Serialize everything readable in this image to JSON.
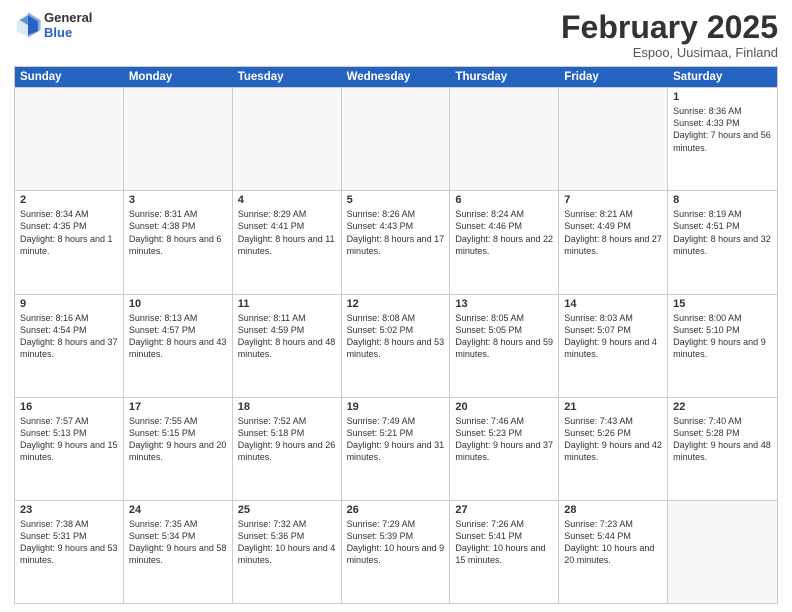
{
  "header": {
    "logo_general": "General",
    "logo_blue": "Blue",
    "month_title": "February 2025",
    "location": "Espoo, Uusimaa, Finland"
  },
  "calendar": {
    "days_of_week": [
      "Sunday",
      "Monday",
      "Tuesday",
      "Wednesday",
      "Thursday",
      "Friday",
      "Saturday"
    ],
    "rows": [
      [
        {
          "day": "",
          "info": "",
          "empty": true
        },
        {
          "day": "",
          "info": "",
          "empty": true
        },
        {
          "day": "",
          "info": "",
          "empty": true
        },
        {
          "day": "",
          "info": "",
          "empty": true
        },
        {
          "day": "",
          "info": "",
          "empty": true
        },
        {
          "day": "",
          "info": "",
          "empty": true
        },
        {
          "day": "1",
          "info": "Sunrise: 8:36 AM\nSunset: 4:33 PM\nDaylight: 7 hours and 56 minutes.",
          "empty": false
        }
      ],
      [
        {
          "day": "2",
          "info": "Sunrise: 8:34 AM\nSunset: 4:35 PM\nDaylight: 8 hours and 1 minute.",
          "empty": false
        },
        {
          "day": "3",
          "info": "Sunrise: 8:31 AM\nSunset: 4:38 PM\nDaylight: 8 hours and 6 minutes.",
          "empty": false
        },
        {
          "day": "4",
          "info": "Sunrise: 8:29 AM\nSunset: 4:41 PM\nDaylight: 8 hours and 11 minutes.",
          "empty": false
        },
        {
          "day": "5",
          "info": "Sunrise: 8:26 AM\nSunset: 4:43 PM\nDaylight: 8 hours and 17 minutes.",
          "empty": false
        },
        {
          "day": "6",
          "info": "Sunrise: 8:24 AM\nSunset: 4:46 PM\nDaylight: 8 hours and 22 minutes.",
          "empty": false
        },
        {
          "day": "7",
          "info": "Sunrise: 8:21 AM\nSunset: 4:49 PM\nDaylight: 8 hours and 27 minutes.",
          "empty": false
        },
        {
          "day": "8",
          "info": "Sunrise: 8:19 AM\nSunset: 4:51 PM\nDaylight: 8 hours and 32 minutes.",
          "empty": false
        }
      ],
      [
        {
          "day": "9",
          "info": "Sunrise: 8:16 AM\nSunset: 4:54 PM\nDaylight: 8 hours and 37 minutes.",
          "empty": false
        },
        {
          "day": "10",
          "info": "Sunrise: 8:13 AM\nSunset: 4:57 PM\nDaylight: 8 hours and 43 minutes.",
          "empty": false
        },
        {
          "day": "11",
          "info": "Sunrise: 8:11 AM\nSunset: 4:59 PM\nDaylight: 8 hours and 48 minutes.",
          "empty": false
        },
        {
          "day": "12",
          "info": "Sunrise: 8:08 AM\nSunset: 5:02 PM\nDaylight: 8 hours and 53 minutes.",
          "empty": false
        },
        {
          "day": "13",
          "info": "Sunrise: 8:05 AM\nSunset: 5:05 PM\nDaylight: 8 hours and 59 minutes.",
          "empty": false
        },
        {
          "day": "14",
          "info": "Sunrise: 8:03 AM\nSunset: 5:07 PM\nDaylight: 9 hours and 4 minutes.",
          "empty": false
        },
        {
          "day": "15",
          "info": "Sunrise: 8:00 AM\nSunset: 5:10 PM\nDaylight: 9 hours and 9 minutes.",
          "empty": false
        }
      ],
      [
        {
          "day": "16",
          "info": "Sunrise: 7:57 AM\nSunset: 5:13 PM\nDaylight: 9 hours and 15 minutes.",
          "empty": false
        },
        {
          "day": "17",
          "info": "Sunrise: 7:55 AM\nSunset: 5:15 PM\nDaylight: 9 hours and 20 minutes.",
          "empty": false
        },
        {
          "day": "18",
          "info": "Sunrise: 7:52 AM\nSunset: 5:18 PM\nDaylight: 9 hours and 26 minutes.",
          "empty": false
        },
        {
          "day": "19",
          "info": "Sunrise: 7:49 AM\nSunset: 5:21 PM\nDaylight: 9 hours and 31 minutes.",
          "empty": false
        },
        {
          "day": "20",
          "info": "Sunrise: 7:46 AM\nSunset: 5:23 PM\nDaylight: 9 hours and 37 minutes.",
          "empty": false
        },
        {
          "day": "21",
          "info": "Sunrise: 7:43 AM\nSunset: 5:26 PM\nDaylight: 9 hours and 42 minutes.",
          "empty": false
        },
        {
          "day": "22",
          "info": "Sunrise: 7:40 AM\nSunset: 5:28 PM\nDaylight: 9 hours and 48 minutes.",
          "empty": false
        }
      ],
      [
        {
          "day": "23",
          "info": "Sunrise: 7:38 AM\nSunset: 5:31 PM\nDaylight: 9 hours and 53 minutes.",
          "empty": false
        },
        {
          "day": "24",
          "info": "Sunrise: 7:35 AM\nSunset: 5:34 PM\nDaylight: 9 hours and 58 minutes.",
          "empty": false
        },
        {
          "day": "25",
          "info": "Sunrise: 7:32 AM\nSunset: 5:36 PM\nDaylight: 10 hours and 4 minutes.",
          "empty": false
        },
        {
          "day": "26",
          "info": "Sunrise: 7:29 AM\nSunset: 5:39 PM\nDaylight: 10 hours and 9 minutes.",
          "empty": false
        },
        {
          "day": "27",
          "info": "Sunrise: 7:26 AM\nSunset: 5:41 PM\nDaylight: 10 hours and 15 minutes.",
          "empty": false
        },
        {
          "day": "28",
          "info": "Sunrise: 7:23 AM\nSunset: 5:44 PM\nDaylight: 10 hours and 20 minutes.",
          "empty": false
        },
        {
          "day": "",
          "info": "",
          "empty": true
        }
      ]
    ]
  }
}
